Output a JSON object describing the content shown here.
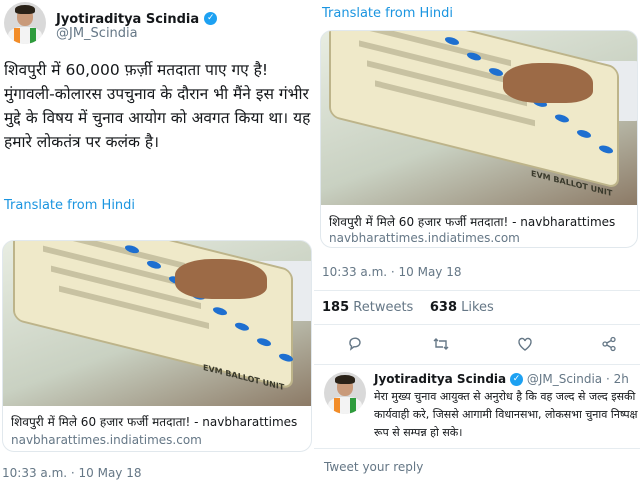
{
  "tweet": {
    "author_name": "Jyotiraditya Scindia",
    "handle": "@JM_Scindia",
    "text": "शिवपुरी में 60,000 फ़र्ज़ी मतदाता पाए गए है! मुंगावली-कोलारस उपचुनाव के दौरान भी मैंने इस गंभीर मुद्दे के विषय में चुनाव आयोग को अवगत किया था। यह हमारे लोकतंत्र पर कलंक है।",
    "translate_label": "Translate from Hindi",
    "timestamp": "10:33 a.m. · 10 May 18",
    "retweets": "185",
    "retweets_label": "Retweets",
    "likes": "638",
    "likes_label": "Likes"
  },
  "card": {
    "title": "शिवपुरी में मिले 60 हजार फर्जी मतदाता! - navbharattimes",
    "url": "navbharattimes.indiatimes.com",
    "image_text": "EVM BALLOT UNIT"
  },
  "reply": {
    "author_name": "Jyotiraditya Scindia",
    "handle": "@JM_Scindia",
    "age": "· 2h",
    "text": "मेरा मुख्य चुनाव आयुक्त से अनुरोध है कि वह जल्द से जल्द इसकी कार्यवाही करे, जिससे आगामी विधानसभा, लोकसभा चुनाव निष्पक्ष रूप से सम्पन्न हो सके।"
  },
  "tweet_your_reply": "Tweet your reply",
  "colors": {
    "link": "#1b95e0",
    "verified": "#1da1f2",
    "muted": "#657786",
    "evm_button": "#1e6fd0"
  }
}
